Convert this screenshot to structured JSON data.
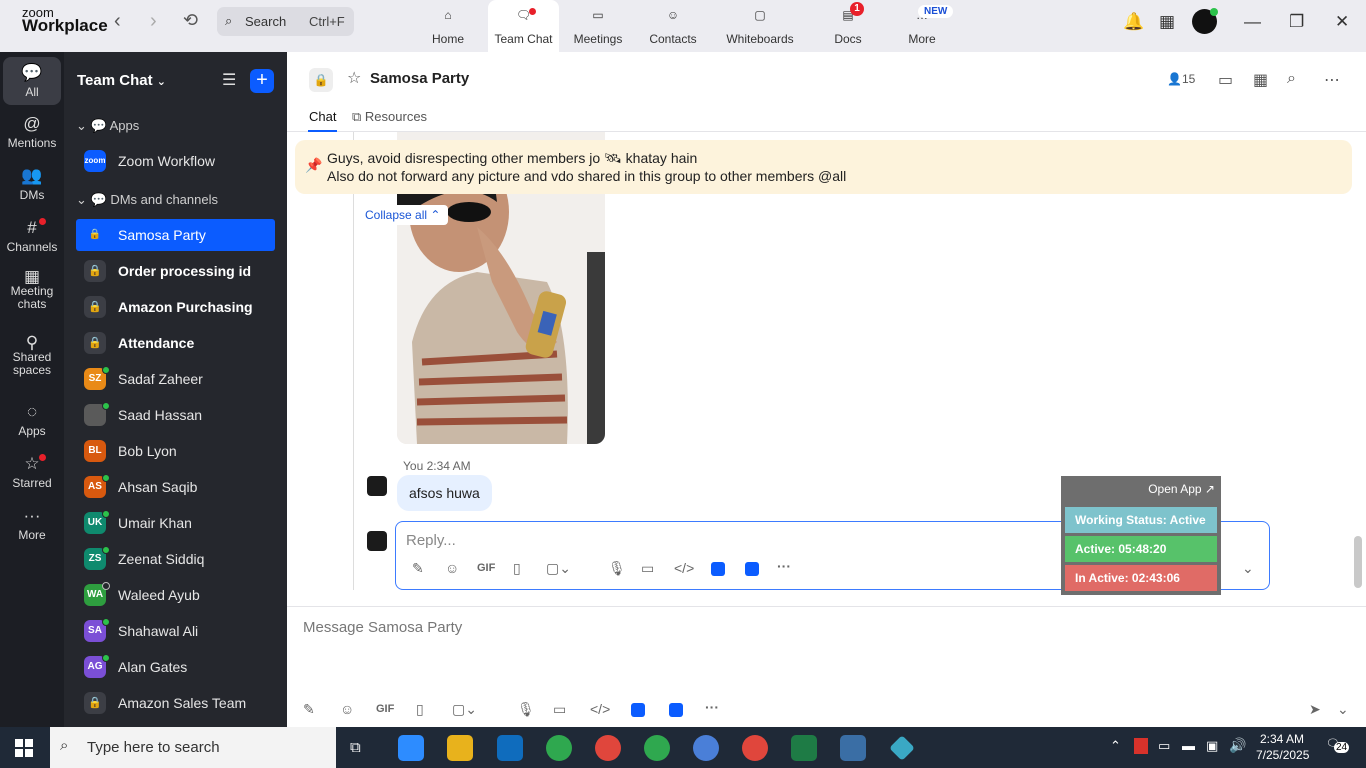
{
  "app": {
    "brand_line1": "zoom",
    "brand_line2": "Workplace"
  },
  "search": {
    "label": "Search",
    "shortcut": "Ctrl+F"
  },
  "top_tabs": [
    {
      "label": "Home",
      "icon": "home-icon"
    },
    {
      "label": "Team Chat",
      "icon": "chat-icon"
    },
    {
      "label": "Meetings",
      "icon": "video-icon"
    },
    {
      "label": "Contacts",
      "icon": "contacts-icon"
    },
    {
      "label": "Whiteboards",
      "icon": "whiteboard-icon"
    },
    {
      "label": "Docs",
      "icon": "docs-icon",
      "badge": "1"
    },
    {
      "label": "More",
      "icon": "more-icon",
      "badge": "NEW"
    }
  ],
  "rail": [
    {
      "label": "All"
    },
    {
      "label": "Mentions"
    },
    {
      "label": "DMs"
    },
    {
      "label": "Channels"
    },
    {
      "label": "Meeting chats"
    },
    {
      "label": "Shared spaces"
    },
    {
      "label": "Apps"
    },
    {
      "label": "Starred"
    },
    {
      "label": "More"
    }
  ],
  "panel": {
    "title": "Team Chat",
    "apps_section": "Apps",
    "apps_item": "Zoom Workflow",
    "apps_item_badge": "zoom",
    "dms_section": "DMs and channels",
    "items": [
      {
        "label": "Samosa Party",
        "type": "lock"
      },
      {
        "label": "Order processing id",
        "type": "lock"
      },
      {
        "label": "Amazon Purchasing",
        "type": "lock"
      },
      {
        "label": "Attendance",
        "type": "lock"
      },
      {
        "label": "Sadaf Zaheer",
        "initials": "SZ",
        "color": "#e98a17"
      },
      {
        "label": "Saad Hassan",
        "initials": "",
        "color": "#5a5a5a"
      },
      {
        "label": "Bob Lyon",
        "initials": "BL",
        "color": "#d8590f"
      },
      {
        "label": "Ahsan Saqib",
        "initials": "AS",
        "color": "#d8590f"
      },
      {
        "label": "Umair Khan",
        "initials": "UK",
        "color": "#0f8a6e"
      },
      {
        "label": "Zeenat Siddiq",
        "initials": "ZS",
        "color": "#0f8a6e"
      },
      {
        "label": "Waleed Ayub",
        "initials": "WA",
        "color": "#2e9e3f"
      },
      {
        "label": "Shahawal Ali",
        "initials": "SA",
        "color": "#7b4fd6"
      },
      {
        "label": "Alan Gates",
        "initials": "AG",
        "color": "#7b4fd6"
      },
      {
        "label": "Amazon Sales Team",
        "type": "lock"
      }
    ]
  },
  "chat": {
    "title": "Samosa Party",
    "member_count": "15",
    "tabs": [
      "Chat",
      "Resources"
    ],
    "pinned_line1": "Guys, avoid disrespecting other members jo 🛰 khatay hain",
    "pinned_line2": "Also do not forward any picture and vdo shared in this group to other members @all",
    "collapse_all": "Collapse all",
    "message_meta": "You 2:34 AM",
    "message_text": "afsos huwa",
    "reply_placeholder": "Reply...",
    "composer_placeholder": "Message Samosa Party",
    "gif_label": "GIF"
  },
  "widget": {
    "open_app": "Open App ↗",
    "status": "Working Status: Active",
    "active": "Active: 05:48:20",
    "inactive": "In Active: 02:43:06",
    "status_color": "#7ec3cc",
    "active_color": "#57c26a",
    "inactive_color": "#e06b66"
  },
  "taskbar": {
    "search": "Type here to search",
    "time": "2:34 AM",
    "date": "7/25/2025",
    "notif": "24"
  }
}
